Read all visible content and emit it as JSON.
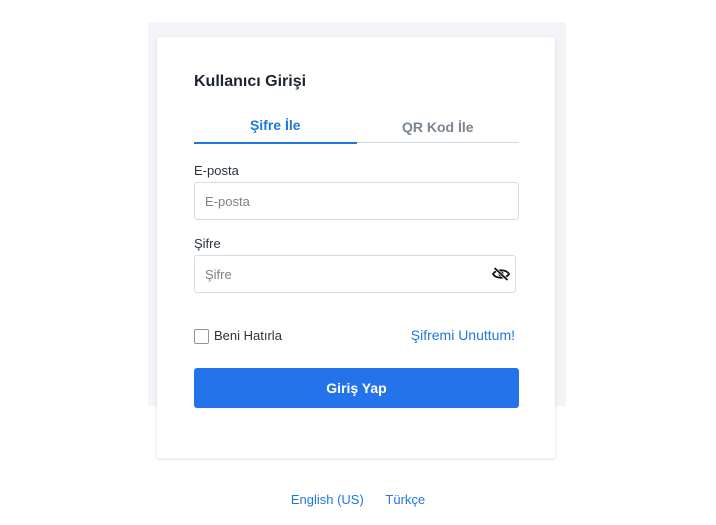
{
  "login": {
    "title": "Kullanıcı Girişi",
    "tabs": [
      {
        "label": "Şifre İle",
        "active": true
      },
      {
        "label": "QR Kod İle",
        "active": false
      }
    ],
    "email": {
      "label": "E-posta",
      "placeholder": "E-posta",
      "value": ""
    },
    "password": {
      "label": "Şifre",
      "placeholder": "Şifre",
      "value": "",
      "toggle_icon": "eye-slash-icon"
    },
    "remember_me": {
      "label": "Beni Hatırla",
      "checked": false
    },
    "forgot_password": "Şifremi Unuttum!",
    "submit_label": "Giriş Yap"
  },
  "languages": [
    {
      "label": "English (US)"
    },
    {
      "label": "Türkçe"
    }
  ],
  "colors": {
    "accent": "#1e78dc",
    "button": "#2473ea",
    "background_panel": "#f3f5f8"
  }
}
